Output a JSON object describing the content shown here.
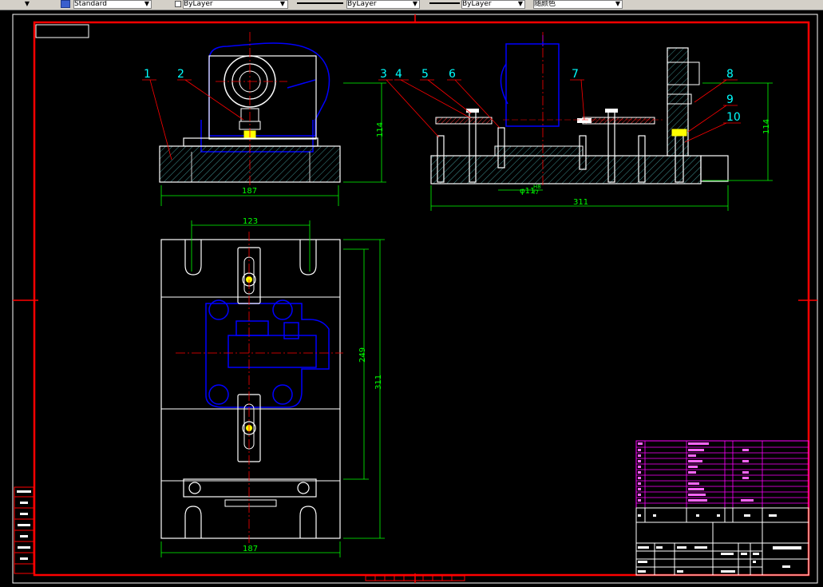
{
  "toolbar": {
    "text_style": "Standard",
    "layer1": "ByLayer",
    "layer2": "ByLayer",
    "layer3": "ByLayer",
    "color": "随颜色"
  },
  "dimensions": {
    "front_width": "187",
    "front_height": "114",
    "side_width": "311",
    "side_height": "114",
    "side_hole": "φ11",
    "side_hole_tol_top": "H8",
    "side_hole_tol_bot": "f7",
    "plan_slot_spacing": "123",
    "plan_inner": "249",
    "plan_height": "311",
    "plan_width": "187"
  },
  "balloons": [
    "1",
    "2",
    "3",
    "4",
    "5",
    "6",
    "7",
    "8",
    "9",
    "10"
  ],
  "colors": {
    "border": "#ff0000",
    "outline": "#ffffff",
    "hidden_part": "#0000ff",
    "dimension": "#00ff00",
    "balloon": "#00ffff",
    "bom": "#ff00ff"
  }
}
